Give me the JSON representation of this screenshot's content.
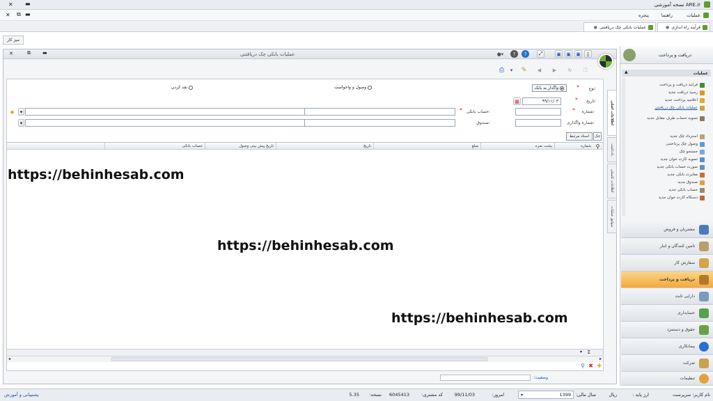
{
  "app": {
    "title": "ARE.ir نسخه آموزشی",
    "menu": [
      "عملیات",
      "راهنما",
      "پنجره"
    ]
  },
  "tabs": [
    {
      "label": "فرآیند راه اندازی"
    },
    {
      "label": "عملیات بانکی چک دریافتنی"
    }
  ],
  "desk_label": "میز کار",
  "form": {
    "title": "عملیات بانکی چک دریافتنی",
    "type_label": "نوع:",
    "radio1": "واگذار به بانک",
    "radio2": "وصول و واخواست",
    "radio3": "نقد کردن",
    "date_label": "تاریخ:",
    "date_value": "۹۹/۱۱/۰۳",
    "number_label": "شماره:",
    "bank_label": "حساب بانکی:",
    "assign_label": "شماره واگذاری:",
    "fund_label": "صندوق:",
    "sub_tabs": [
      "چک",
      "اسناد مرتبط"
    ],
    "columns": [
      "شماره",
      "پشت نمره",
      "مبلغ",
      "تاریخ",
      "تاریخ پیش بینی وصول",
      "حساب بانکی"
    ],
    "status_label": "وضعیت:",
    "vertical_tabs": [
      "اطلاعات اصلی",
      "یادداشت",
      "اطلاعات تکمیلی",
      "سوابق عملیات"
    ]
  },
  "watermarks": [
    "https://behinhesab.com",
    "https://behinhesab.com",
    "https://behinhesab.com"
  ],
  "sidebar": {
    "header": "دریافت و پرداخت",
    "section": "عملیات",
    "items": [
      "فرآیند دریافت و پرداخت",
      "رسید دریافت جدید",
      "اعلامیه پرداخت جدید",
      "عملیات بانکی چک دریافتنی",
      "تسویه حساب طرف مقابل جدید",
      "استرداد چک جدید",
      "وصول چک پرداختنی",
      "جستجو چک",
      "تسویه کارت خوان جدید",
      "صورت حساب بانکی جدید",
      "مغایرت بانکی جدید",
      "صندوق جدید",
      "حساب بانکی جدید",
      "دستگاه کارت خوان جدید"
    ],
    "nav": [
      "مشتریان و فروش",
      "تامین کنندگان و انبار",
      "سفارش کار",
      "دریافت و پرداخت",
      "دارایی ثابت",
      "حسابداری",
      "حقوق و دستمزد",
      "پیمانکاری",
      "شرکت",
      "تنظیمات"
    ]
  },
  "statusbar": {
    "user": "نام کاربر: سرپرست",
    "from": "ارز پایه :",
    "currency": "ریال",
    "fiscal": "سال مالی:",
    "year": "1399",
    "today_label": "امروز:",
    "today": "99/11/03",
    "customer_label": "کد مشتری:",
    "customer": "6045413",
    "version_label": "نسخه:",
    "version": "5.35",
    "support": "پشتیبانی و آموزش"
  },
  "colors": {
    "accent": "#f3a83a",
    "chrome": "#dfe3e8",
    "border": "#9aa6b6"
  }
}
